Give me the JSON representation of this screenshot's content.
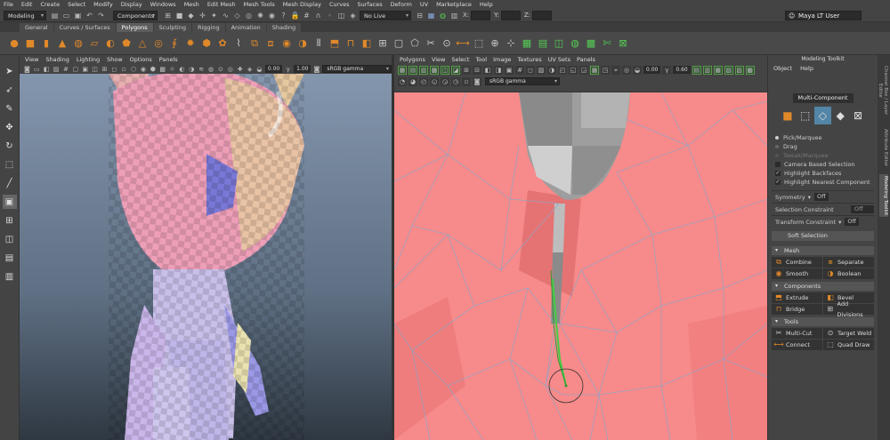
{
  "menubar": [
    "File",
    "Edit",
    "Create",
    "Select",
    "Modify",
    "Display",
    "Windows",
    "Mesh",
    "Edit Mesh",
    "Mesh Tools",
    "Mesh Display",
    "Curves",
    "Surfaces",
    "Deform",
    "UV",
    "Marketplace",
    "Help"
  ],
  "status": {
    "workspace_value": "Modeling",
    "select_mode_value": "Components",
    "live_surface": "No Live Surface",
    "x_label": "X:",
    "y_label": "Y:",
    "z_label": "Z:",
    "user": "Maya LT User"
  },
  "shelf_tabs": [
    "General",
    "Curves / Surfaces",
    "Polygons",
    "Sculpting",
    "Rigging",
    "Animation",
    "Shading"
  ],
  "shelf_active_index": 2,
  "viewport": {
    "menu": [
      "View",
      "Shading",
      "Lighting",
      "Show",
      "Options",
      "Panels"
    ],
    "exposure": "0.00",
    "gamma": "1.00",
    "color_space": "sRGB gamma"
  },
  "uv_editor": {
    "menu": [
      "Polygons",
      "View",
      "Select",
      "Tool",
      "Image",
      "Textures",
      "UV Sets",
      "Panels"
    ],
    "exposure": "0.00",
    "gamma": "0.60",
    "color_space": "sRGB gamma"
  },
  "modeling_toolkit": {
    "title": "Modeling Toolkit",
    "menu": [
      "Object",
      "Help"
    ],
    "mode_label": "Multi-Component",
    "pick_marquee": "Pick/Marquee",
    "drag": "Drag",
    "tweak_marquee": "Tweak/Marquee",
    "camera_based": "Camera Based Selection",
    "highlight_backfaces": "Highlight Backfaces",
    "highlight_nearest": "Highlight Nearest Component",
    "symmetry_label": "Symmetry",
    "symmetry_value": "Off",
    "selection_constraint_label": "Selection Constraint",
    "selection_constraint_value": "Off",
    "transform_constraint_label": "Transform Constraint",
    "transform_constraint_value": "Off",
    "soft_selection": "Soft Selection",
    "mesh_section": "Mesh",
    "combine": "Combine",
    "separate": "Separate",
    "smooth": "Smooth",
    "boolean": "Boolean",
    "components_section": "Components",
    "extrude": "Extrude",
    "bevel": "Bevel",
    "bridge": "Bridge",
    "add_divisions": "Add Divisions",
    "tools_section": "Tools",
    "multi_cut": "Multi-Cut",
    "target_weld": "Target Weld",
    "connect": "Connect",
    "quad_draw": "Quad Draw"
  },
  "side_tabs": {
    "channel_box": "Channel Box / Layer Editor",
    "attribute_editor": "Attribute Editor",
    "modeling_toolkit": "Modeling Toolkit"
  },
  "colors": {
    "ui_bg": "#444444",
    "mesh_pink": "#ff8a8a",
    "selection_green": "#44cc44",
    "active_blue": "#5285a6",
    "shelf_orange": "#e0892a"
  }
}
